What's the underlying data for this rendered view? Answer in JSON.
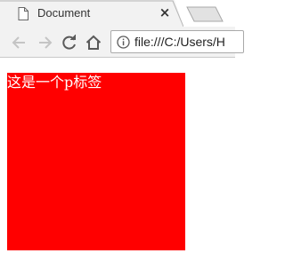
{
  "browser": {
    "tab": {
      "title": "Document",
      "close_symbol": "×",
      "icon": "document-icon"
    },
    "toolbar": {
      "back_icon": "arrow-left-icon",
      "forward_icon": "arrow-right-icon",
      "reload_icon": "reload-icon",
      "home_icon": "home-icon",
      "info_icon": "info-icon"
    },
    "address_bar": {
      "url": "file:///C:/Users/H"
    }
  },
  "page": {
    "box": {
      "text": "这是一个p标签",
      "background_color": "#ff0000",
      "text_color": "#ffffff"
    }
  }
}
